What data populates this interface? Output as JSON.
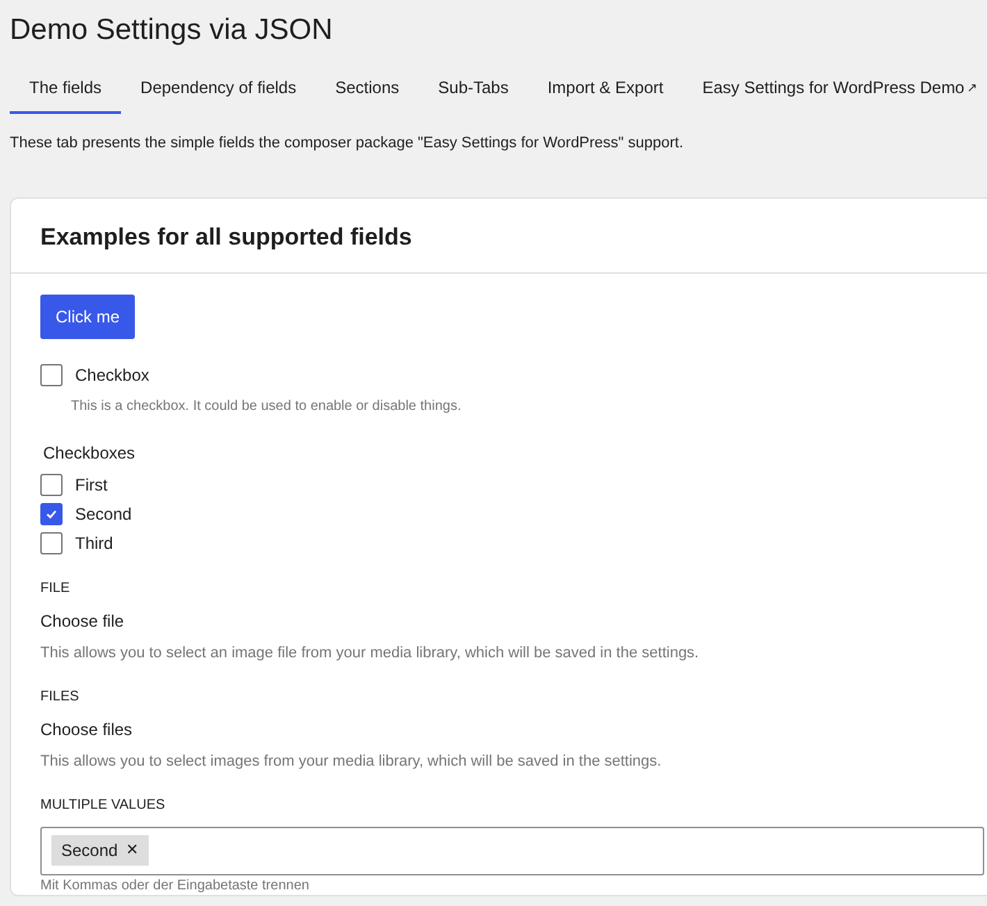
{
  "page_title": "Demo Settings via JSON",
  "tabs": [
    {
      "label": "The fields",
      "selected": true,
      "external": false
    },
    {
      "label": "Dependency of fields",
      "selected": false,
      "external": false
    },
    {
      "label": "Sections",
      "selected": false,
      "external": false
    },
    {
      "label": "Sub-Tabs",
      "selected": false,
      "external": false
    },
    {
      "label": "Import & Export",
      "selected": false,
      "external": false
    },
    {
      "label": "Easy Settings for WordPress Demo",
      "selected": false,
      "external": true,
      "external_symbol": "↗"
    }
  ],
  "intro": "These tab presents the simple fields the composer package \"Easy Settings for WordPress\" support.",
  "card": {
    "title": "Examples for all supported fields",
    "button": "Click me",
    "checkbox": {
      "label": "Checkbox",
      "checked": false,
      "description": "This is a checkbox. It could be used to enable or disable things."
    },
    "checkboxes": {
      "label": "Checkboxes",
      "options": [
        {
          "label": "First",
          "checked": false
        },
        {
          "label": "Second",
          "checked": true
        },
        {
          "label": "Third",
          "checked": false
        }
      ]
    },
    "file": {
      "label": "FILE",
      "link": "Choose file",
      "description": "This allows you to select an image file from your media library, which will be saved in the settings."
    },
    "files": {
      "label": "FILES",
      "link": "Choose files",
      "description": "This allows you to select images from your media library, which will be saved in the settings."
    },
    "multiple_values": {
      "label": "MULTIPLE VALUES",
      "tags": [
        "Second"
      ],
      "remove_symbol": "✕",
      "description": "Mit Kommas oder der Eingabetaste trennen"
    }
  }
}
